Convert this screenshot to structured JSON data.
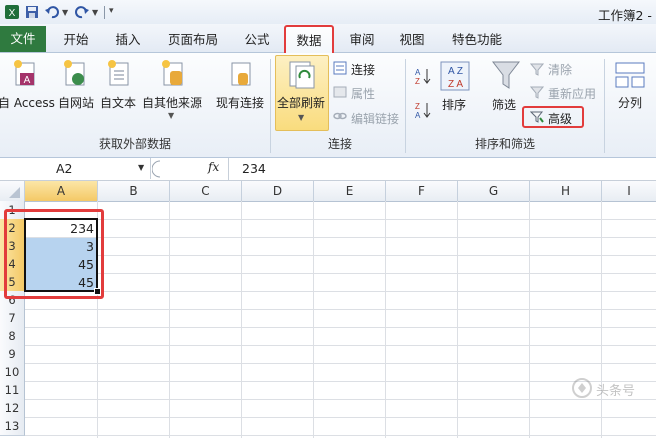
{
  "window": {
    "title": "工作簿2 -"
  },
  "quick_access": {
    "icons": [
      "save-icon",
      "undo-icon",
      "redo-icon",
      "customize-icon"
    ]
  },
  "tabs": {
    "file": "文件",
    "items": [
      "开始",
      "插入",
      "页面布局",
      "公式",
      "数据",
      "审阅",
      "视图",
      "特色功能"
    ],
    "active": "数据"
  },
  "ribbon": {
    "external_data": {
      "access": "自 Access",
      "web": "自网站",
      "text": "自文本",
      "other": "自其他来源",
      "existing": "现有连接",
      "group_label": "获取外部数据"
    },
    "connections": {
      "refresh_all": "全部刷新",
      "connect": "连接",
      "properties": "属性",
      "edit_links": "编辑链接",
      "group_label": "连接"
    },
    "sort_filter": {
      "sort": "排序",
      "filter": "筛选",
      "clear": "清除",
      "reapply": "重新应用",
      "advanced": "高级",
      "group_label": "排序和筛选"
    },
    "data_tools": {
      "split": "分列"
    }
  },
  "formula_bar": {
    "name_box": "A2",
    "fx": "fx",
    "value": "234"
  },
  "sheet": {
    "columns": [
      "A",
      "B",
      "C",
      "D",
      "E",
      "F",
      "G",
      "H",
      "I"
    ],
    "rows": [
      "1",
      "2",
      "3",
      "4",
      "5",
      "6",
      "7",
      "8",
      "9",
      "10",
      "11",
      "12",
      "13"
    ],
    "cells": {
      "A2": "234",
      "A3": "3",
      "A4": "45",
      "A5": "45"
    }
  },
  "watermark": "头条号",
  "colors": {
    "file_tab": "#2f7a3f",
    "highlight_box": "#e23c3c",
    "selection": "#b7d3ef",
    "active_header": "#f6d77c"
  }
}
